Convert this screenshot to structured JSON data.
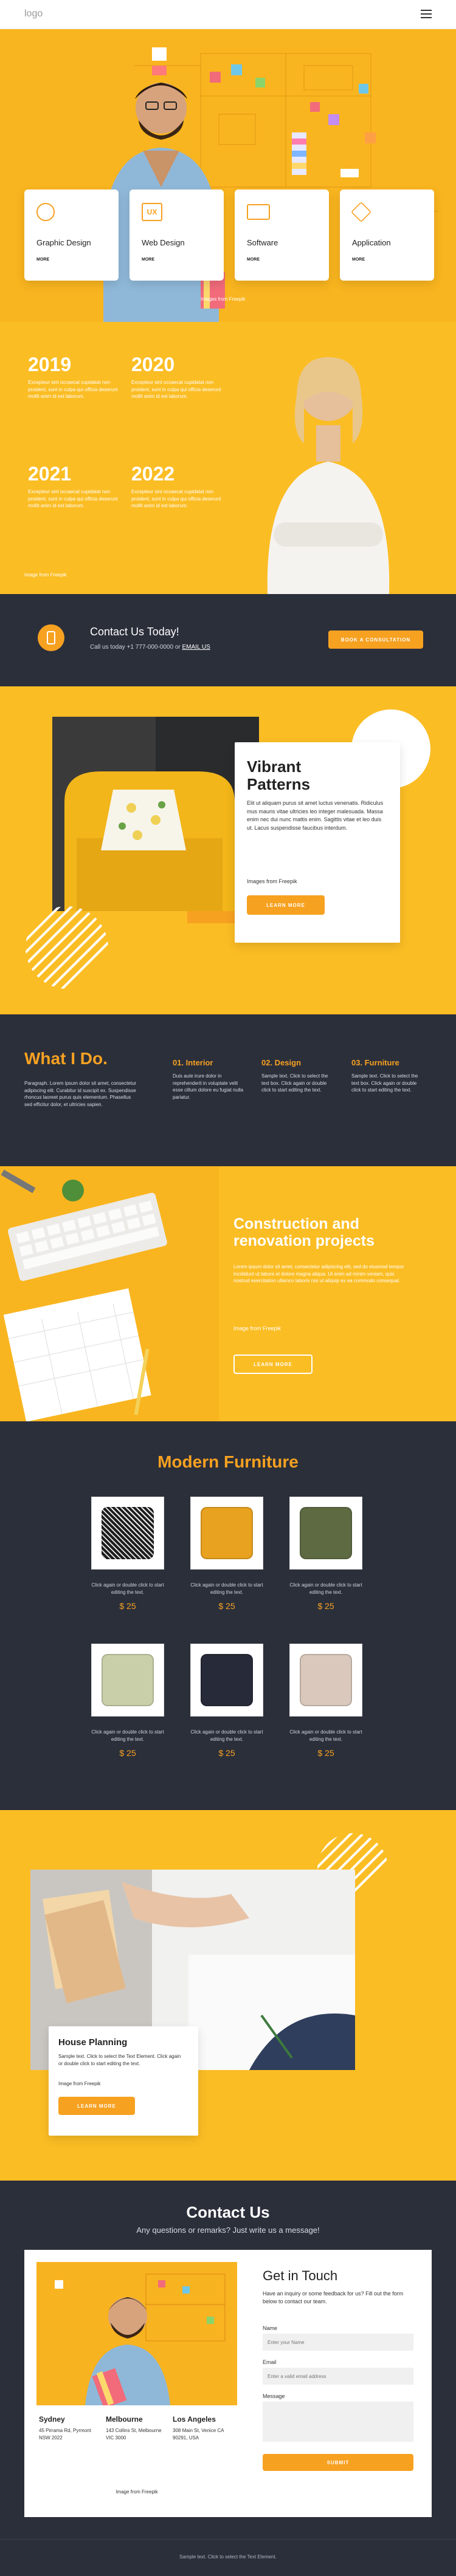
{
  "header": {
    "logo": "logo"
  },
  "hero": {
    "services": [
      {
        "title": "Graphic Design",
        "more": "MORE"
      },
      {
        "title": "Web Design",
        "more": "MORE"
      },
      {
        "title": "Software",
        "more": "MORE"
      },
      {
        "title": "Application",
        "more": "MORE"
      }
    ],
    "credit": "Images from Freepik"
  },
  "timeline": {
    "items": [
      {
        "year": "2019",
        "text": "Excepteur sint occaecat cupidatat non proident, sunt in culpa qui officia deserunt mollit anim id est laborum."
      },
      {
        "year": "2020",
        "text": "Excepteur sint occaecat cupidatat non proident, sunt in culpa qui officia deserunt mollit anim id est laborum."
      },
      {
        "year": "2021",
        "text": "Excepteur sint occaecat cupidatat non proident, sunt in culpa qui officia deserunt mollit anim id est laborum."
      },
      {
        "year": "2022",
        "text": "Excepteur sint occaecat cupidatat non proident, sunt in culpa qui officia deserunt mollit anim id est laborum."
      }
    ],
    "credit": "Image from Freepik"
  },
  "contact_bar": {
    "title": "Contact Us Today!",
    "call_prefix": "Call us today +1 777-000-0000 or",
    "email_label": "EMAIL US",
    "button": "BOOK A CONSULTATION"
  },
  "vibrant": {
    "title": "Vibrant Patterns",
    "text": "Elit ut aliquam purus sit amet luctus venenatis. Ridiculus mus mauris vitae ultricies leo integer malesuada. Massa enim nec dui nunc mattis enim. Sagittis vitae et leo duis ut. Lacus suspendisse faucibus interdum.",
    "credit": "Images from Freepik",
    "button": "LEARN MORE"
  },
  "what": {
    "title": "What I Do.",
    "intro": "Paragraph. Lorem ipsum dolor sit amet, consectetur adipiscing elit. Curabitur id suscipit ex. Suspendisse rhoncus laoreet purus quis elementum. Phasellus sed efficitur dolor, et ultricies sapien.",
    "cols": [
      {
        "title": "01. Interior",
        "text": "Duis aute irure dolor in reprehenderit in voluptate velit esse cillum dolore eu fugiat nulla pariatur."
      },
      {
        "title": "02. Design",
        "text": "Sample text. Click to select the text box. Click again or double click to start editing the text."
      },
      {
        "title": "03. Furniture",
        "text": "Sample text. Click to select the text box. Click again or double click to start editing the text."
      }
    ]
  },
  "construction": {
    "title": "Construction and renovation projects",
    "text": "Lorem ipsum dolor sit amet, consectetur adipiscing elit, sed do eiusmod tempor incididunt ut labore et dolore magna aliqua. Ut enim ad minim veniam, quis nostrud exercitation ullamco laboris nisi ut aliquip ex ea commodo consequat.",
    "credit": "Image from Freepik",
    "button": "LEARN MORE"
  },
  "furniture": {
    "title": "Modern Furniture",
    "items": [
      {
        "color": "#1f1f1f",
        "desc": "Click again or double click to start editing the text.",
        "price": "$ 25"
      },
      {
        "color": "#e8a21f",
        "desc": "Click again or double click to start editing the text.",
        "price": "$ 25"
      },
      {
        "color": "#5e6a42",
        "desc": "Click again or double click to start editing the text.",
        "price": "$ 25"
      },
      {
        "color": "#c9cfa9",
        "desc": "Click again or double click to start editing the text.",
        "price": "$ 25"
      },
      {
        "color": "#272a38",
        "desc": "Click again or double click to start editing the text.",
        "price": "$ 25"
      },
      {
        "color": "#d9c8bb",
        "desc": "Click again or double click to start editing the text.",
        "price": "$ 25"
      }
    ]
  },
  "house": {
    "title": "House Planning",
    "text": "Sample text. Click to select the Text Element. Click again or double click to start editing the text.",
    "credit": "Image from Freepik",
    "button": "LEARN MORE"
  },
  "contact": {
    "title": "Contact Us",
    "subtitle": "Any questions or remarks? Just write us a message!",
    "offices": [
      {
        "city": "Sydney",
        "address": "45 Pirrama Rd, Pyrmont NSW 2022"
      },
      {
        "city": "Melbourne",
        "address": "143 Collins St, Melbourne VIC 3000"
      },
      {
        "city": "Los Angeles",
        "address": "308 Main St, Venice CA 90291, USA"
      }
    ],
    "credit": "Image from Freepik",
    "form_title": "Get in Touch",
    "form_text": "Have an inquiry or some feedback for us? Fill out the form below to contact our team.",
    "name_label": "Name",
    "name_placeholder": "Enter your Name",
    "email_label": "Email",
    "email_placeholder": "Enter a valid email address",
    "message_label": "Message",
    "submit": "SUBMIT"
  },
  "footer": {
    "text": "Sample text. Click to select the Text Element."
  },
  "colors": {
    "accent": "#f7a121",
    "dark": "#2b2f3a",
    "yellow": "#fbbd24"
  }
}
